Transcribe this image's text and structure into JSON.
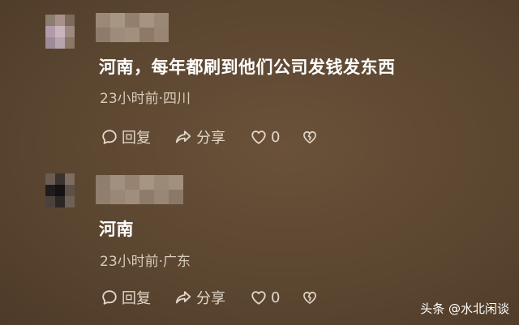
{
  "comments": [
    {
      "text": "河南，每年都刷到他们公司发钱发东西",
      "time": "23小时前",
      "separator": "·",
      "location": "四川",
      "reply_label": "回复",
      "share_label": "分享",
      "like_count": "0"
    },
    {
      "text": "河南",
      "time": "23小时前",
      "separator": "·",
      "location": "广东",
      "reply_label": "回复",
      "share_label": "分享",
      "like_count": "0"
    }
  ],
  "watermark": "头条 @水北闲谈",
  "icons": {
    "reply": "comment-bubble-icon",
    "share": "share-arrow-icon",
    "like": "heart-icon",
    "dislike": "broken-heart-icon"
  },
  "colors": {
    "background": "#5b4632",
    "comment_text": "#ffffff",
    "meta_text": "#d7cab8",
    "action_text": "#e2d7c8"
  }
}
